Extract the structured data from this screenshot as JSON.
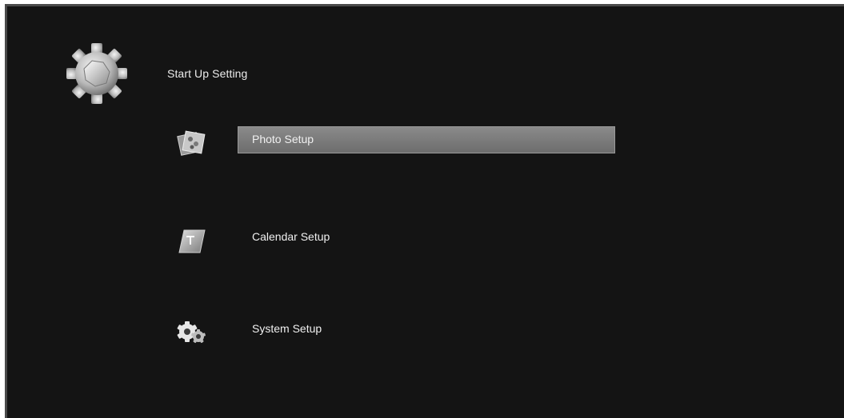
{
  "header": {
    "title": "Start Up Setting",
    "icon": "gear-icon"
  },
  "menu": {
    "items": [
      {
        "label": "Photo Setup",
        "icon": "photos-icon",
        "selected": true
      },
      {
        "label": "Calendar Setup",
        "icon": "calendar-icon",
        "selected": false
      },
      {
        "label": "System Setup",
        "icon": "gears-icon",
        "selected": false
      }
    ]
  },
  "colors": {
    "background": "#141414",
    "highlight": "#7a7a7a",
    "text": "#f0f0f0"
  }
}
